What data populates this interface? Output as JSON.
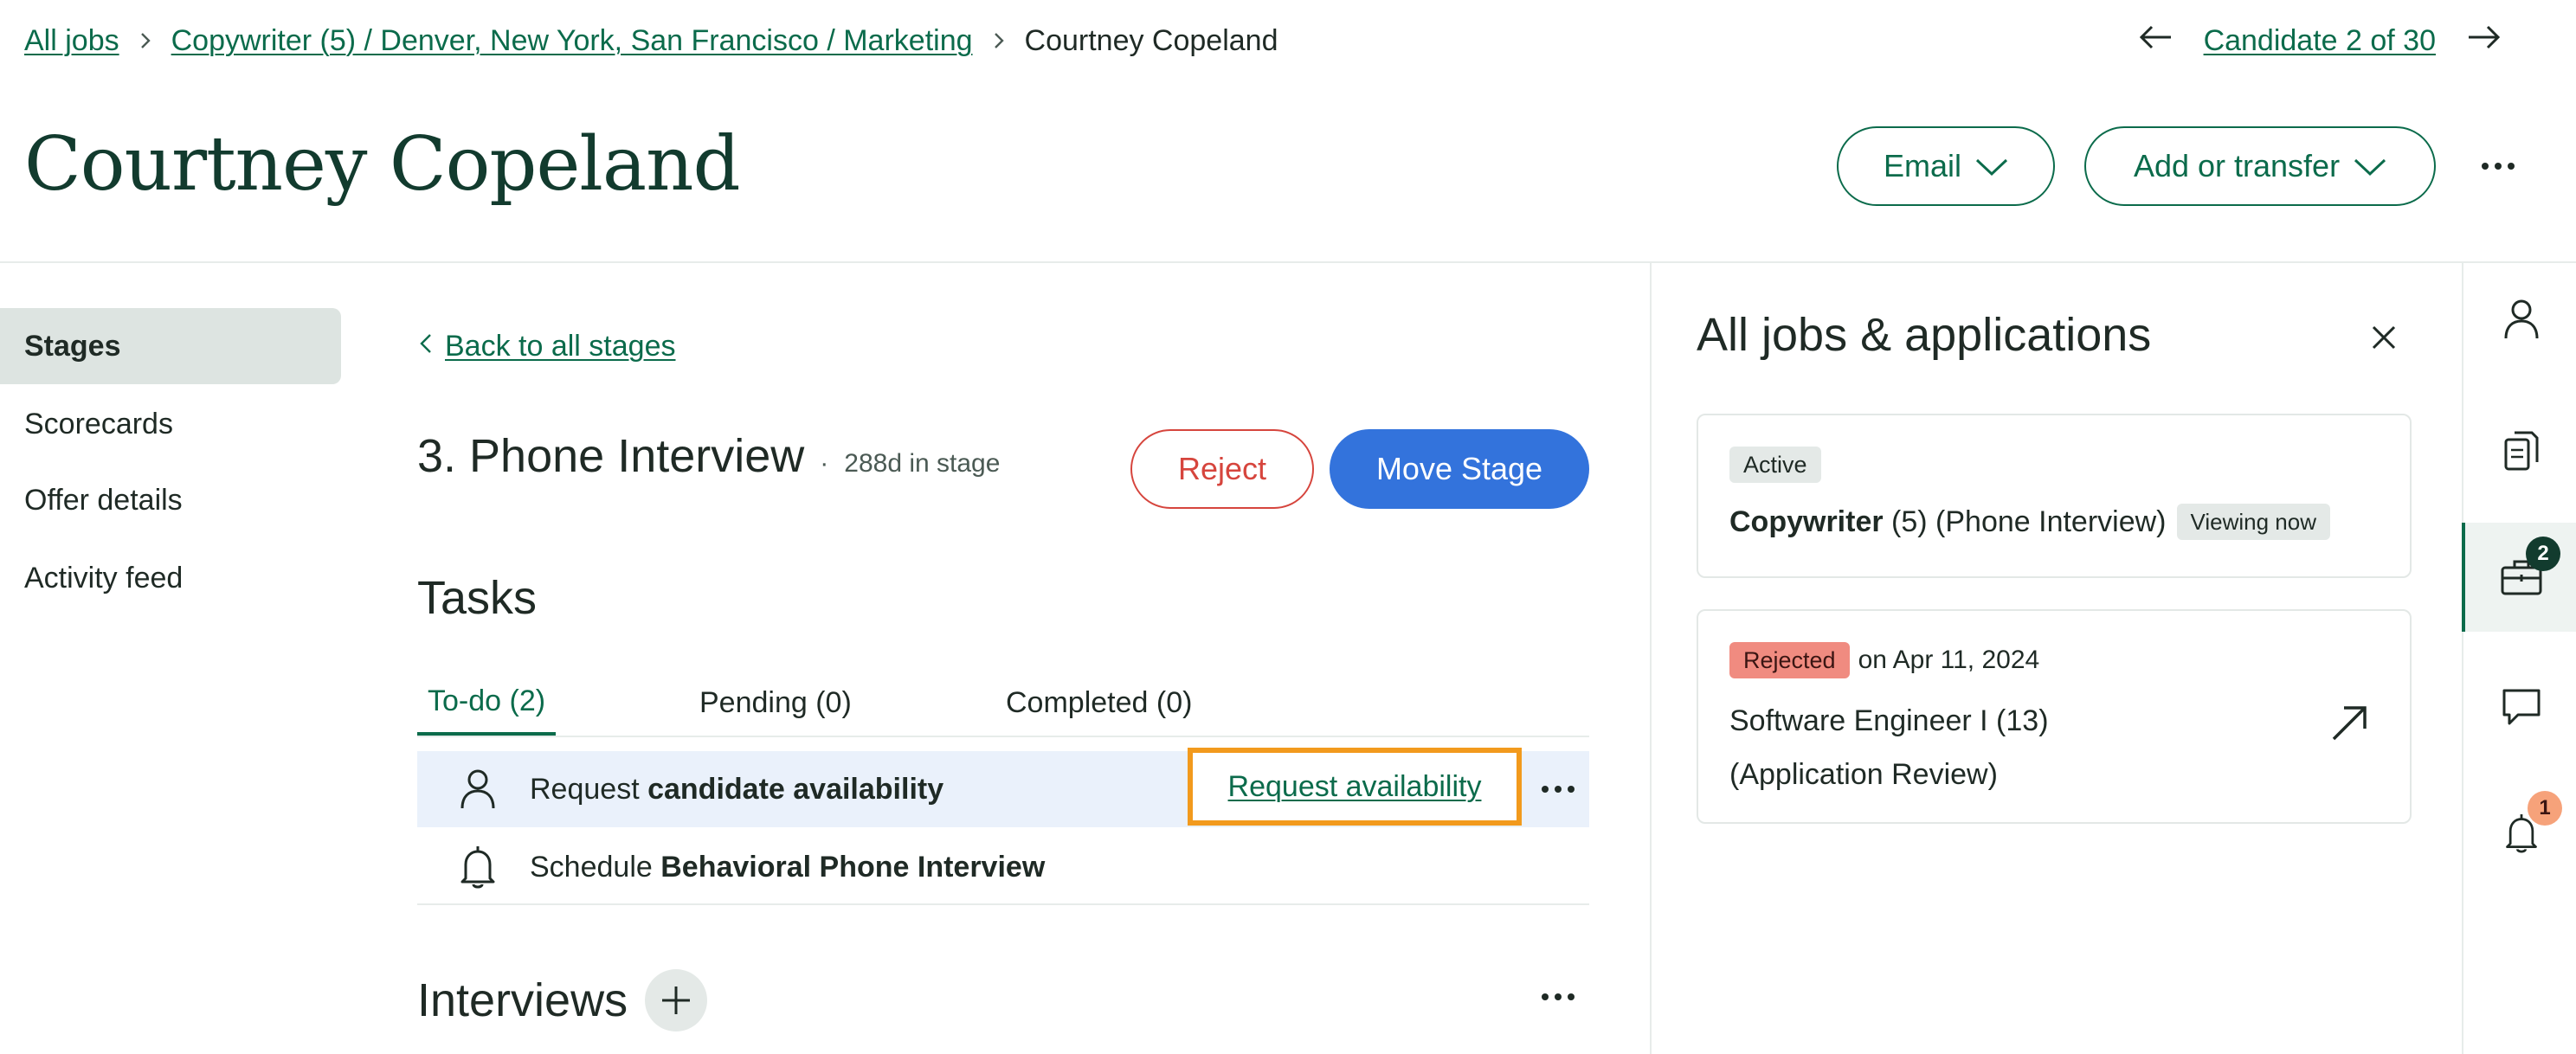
{
  "breadcrumb": {
    "all_jobs": "All jobs",
    "job": "Copywriter (5) / Denver, New York, San Francisco / Marketing",
    "current": "Courtney Copeland"
  },
  "candidate_nav": {
    "label": "Candidate 2 of 30"
  },
  "header": {
    "name": "Courtney Copeland",
    "email_label": "Email",
    "add_transfer_label": "Add or transfer"
  },
  "sidebar": {
    "items": [
      {
        "label": "Stages",
        "active": true
      },
      {
        "label": "Scorecards",
        "active": false
      },
      {
        "label": "Offer details",
        "active": false
      },
      {
        "label": "Activity feed",
        "active": false
      }
    ]
  },
  "stage": {
    "back_label": "Back to all stages",
    "title": "3. Phone Interview",
    "days_in_stage": "288d in stage",
    "reject_label": "Reject",
    "move_label": "Move Stage"
  },
  "tasks": {
    "heading": "Tasks",
    "tabs": [
      {
        "label": "To-do (2)",
        "active": true
      },
      {
        "label": "Pending (0)",
        "active": false
      },
      {
        "label": "Completed (0)",
        "active": false
      }
    ],
    "items": [
      {
        "icon": "person-icon",
        "prefix": "Request ",
        "bold": "candidate availability",
        "action": "Request availability"
      },
      {
        "icon": "bell-icon",
        "prefix": "Schedule ",
        "bold": "Behavioral Phone Interview"
      }
    ]
  },
  "interviews": {
    "heading": "Interviews"
  },
  "panel": {
    "title": "All jobs & applications",
    "cards": [
      {
        "status": "Active",
        "job_bold": "Copywriter",
        "job_rest": " (5) (Phone Interview)",
        "tag": "Viewing now"
      },
      {
        "status": "Rejected",
        "date": "on Apr 11, 2024",
        "line1": "Software Engineer I (13)",
        "line2": "(Application Review)"
      }
    ]
  },
  "rail": {
    "jobs_count": "2",
    "notifications_count": "1"
  },
  "colors": {
    "brand_green": "#0b6b4b",
    "primary_blue": "#3373dc",
    "reject_red": "#d6453d",
    "highlight_orange": "#f29a1d",
    "rejected_badge": "#f08b80",
    "notification_badge": "#f6a27a"
  }
}
